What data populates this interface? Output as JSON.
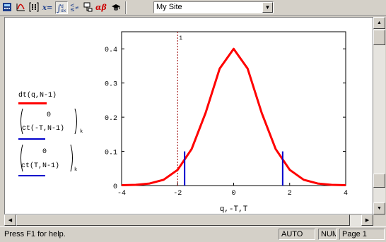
{
  "toolbar": {
    "icons": [
      "calculator-icon",
      "graph-icon",
      "matrix-icon",
      "evaluation-icon",
      "calculus-icon",
      "boolean-icon",
      "programming-icon",
      "greek-icon",
      "symbolic-icon"
    ],
    "site_label": "My Site"
  },
  "legend": {
    "trace1": "dt(q,N-1)",
    "trace2_top": "0",
    "trace2_bottom": "ct(-T,N-1)",
    "trace2_sub": "k",
    "trace3_top": "0",
    "trace3_bottom": "ct(T,N-1)",
    "trace3_sub": "k",
    "colors": {
      "trace1": "#ff0000",
      "trace2": "#0000cc",
      "trace3": "#0000cc",
      "marker": "#990000"
    }
  },
  "chart_data": {
    "type": "line",
    "x": [
      -4,
      -3.5,
      -3,
      -2.5,
      -2,
      -1.5,
      -1,
      -0.5,
      0,
      0.5,
      1,
      1.5,
      2,
      2.5,
      3,
      3.5,
      4
    ],
    "series": [
      {
        "values": [
          0.001,
          0.002,
          0.006,
          0.017,
          0.046,
          0.107,
          0.213,
          0.342,
          0.4,
          0.342,
          0.213,
          0.107,
          0.046,
          0.017,
          0.006,
          0.002,
          0.001
        ]
      }
    ],
    "vertical_lines": [
      {
        "x": -1.75,
        "y": 0.1
      },
      {
        "x": 1.75,
        "y": 0.1
      }
    ],
    "marker_x": -2,
    "xlabel": "q,-T,T",
    "xlim": [
      -4,
      4
    ],
    "ylim": [
      0,
      0.45
    ],
    "xticks": [
      "-4",
      "-2",
      "0",
      "2",
      "4"
    ],
    "yticks": [
      "0",
      "0.1",
      "0.2",
      "0.3",
      "0.4"
    ],
    "marker_label": "1"
  },
  "status": {
    "help": "Press F1 for help.",
    "mode": "AUTO",
    "num": "NUM",
    "page": "Page 1"
  }
}
